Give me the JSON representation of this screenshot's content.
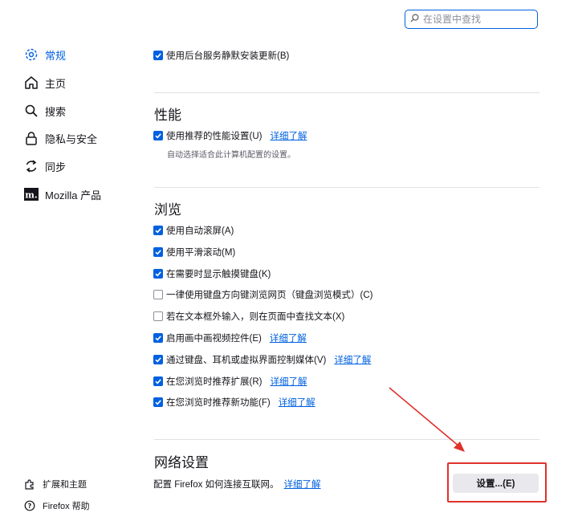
{
  "search": {
    "placeholder": "在设置中查找"
  },
  "sidebar": {
    "items": [
      {
        "label": "常规",
        "icon": "gear-icon"
      },
      {
        "label": "主页",
        "icon": "home-icon"
      },
      {
        "label": "搜索",
        "icon": "search-icon"
      },
      {
        "label": "隐私与安全",
        "icon": "lock-icon"
      },
      {
        "label": "同步",
        "icon": "sync-icon"
      },
      {
        "label": "Mozilla 产品",
        "icon": "mozilla-icon"
      }
    ],
    "footer": [
      {
        "label": "扩展和主题",
        "icon": "puzzle-icon"
      },
      {
        "label": "Firefox 帮助",
        "icon": "help-icon"
      }
    ]
  },
  "updates": {
    "background_update": {
      "label": "使用后台服务静默安装更新(B)",
      "checked": true
    }
  },
  "performance": {
    "heading": "性能",
    "recommended": {
      "label": "使用推荐的性能设置(U)",
      "checked": true,
      "link": "详细了解"
    },
    "description": "自动选择适合此计算机配置的设置。"
  },
  "browsing": {
    "heading": "浏览",
    "options": [
      {
        "label": "使用自动滚屏(A)",
        "checked": true,
        "link": ""
      },
      {
        "label": "使用平滑滚动(M)",
        "checked": true,
        "link": ""
      },
      {
        "label": "在需要时显示触摸键盘(K)",
        "checked": true,
        "link": ""
      },
      {
        "label": "一律使用键盘方向键浏览网页（键盘浏览模式）(C)",
        "checked": false,
        "link": ""
      },
      {
        "label": "若在文本框外输入，则在页面中查找文本(X)",
        "checked": false,
        "link": ""
      },
      {
        "label": "启用画中画视频控件(E)",
        "checked": true,
        "link": "详细了解"
      },
      {
        "label": "通过键盘、耳机或虚拟界面控制媒体(V)",
        "checked": true,
        "link": "详细了解"
      },
      {
        "label": "在您浏览时推荐扩展(R)",
        "checked": true,
        "link": "详细了解"
      },
      {
        "label": "在您浏览时推荐新功能(F)",
        "checked": true,
        "link": "详细了解"
      }
    ]
  },
  "network": {
    "heading": "网络设置",
    "description": "配置 Firefox 如何连接互联网。",
    "link": "详细了解",
    "button": "设置...(E)"
  },
  "colors": {
    "accent": "#0061e0",
    "annotation": "#e0312b"
  }
}
